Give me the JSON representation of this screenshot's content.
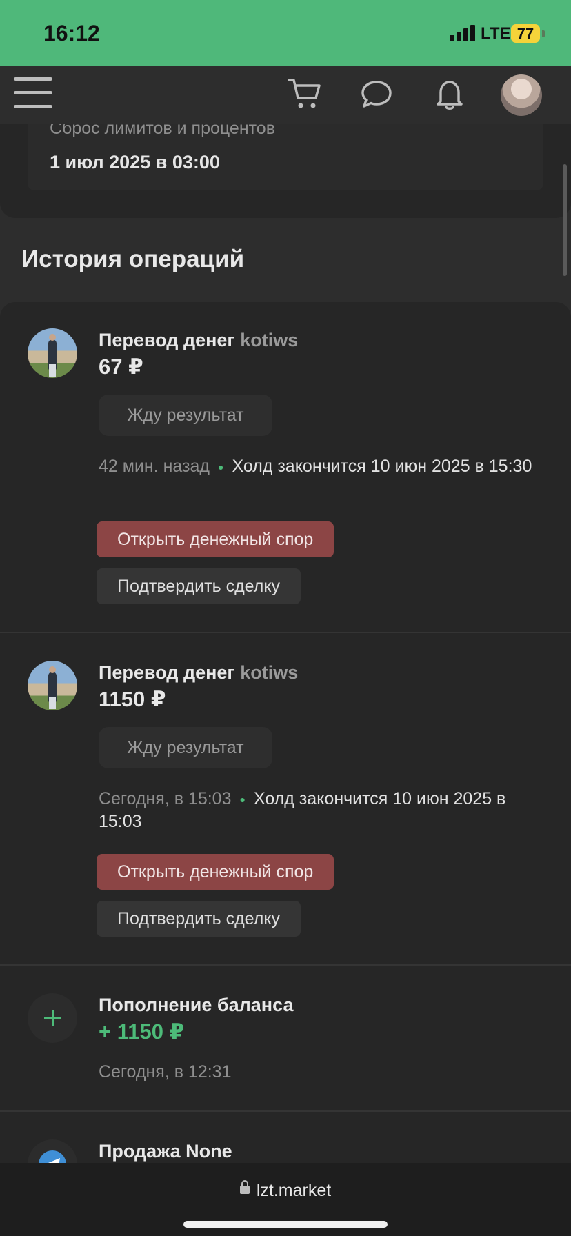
{
  "status_bar": {
    "time": "16:12",
    "network": "LTE",
    "battery": "77"
  },
  "nav": {
    "icons": [
      "menu-icon",
      "cart-icon",
      "chat-icon",
      "bell-icon",
      "avatar"
    ]
  },
  "limits": {
    "label": "Сброс лимитов и процентов",
    "value": "1 июл 2025 в 03:00"
  },
  "history": {
    "title": "История операций",
    "operations": [
      {
        "title": "Перевод денег",
        "user": "kotiws",
        "amount": "67 ₽",
        "status": "Жду результат",
        "when": "42 мин. назад",
        "hold": "Холд закончится 10 июн 2025 в 15:30",
        "dispute_label": "Открыть денежный спор",
        "confirm_label": "Подтвердить сделку"
      },
      {
        "title": "Перевод денег",
        "user": "kotiws",
        "amount": "1150 ₽",
        "status": "Жду результат",
        "when": "Сегодня, в 15:03",
        "hold": "Холд закончится 10 июн 2025 в 15:03",
        "dispute_label": "Открыть денежный спор",
        "confirm_label": "Подтвердить сделку"
      },
      {
        "title": "Пополнение баланса",
        "amount": "+ 1150 ₽",
        "when": "Сегодня, в 12:31"
      },
      {
        "title": "Продажа None"
      }
    ]
  },
  "url_bar": {
    "url": "lzt.market"
  },
  "colors": {
    "status_bar": "#4fb87a",
    "accent_green": "#4dbb79",
    "dispute_button": "#8c4545",
    "background": "#2d2d2d",
    "card": "#262626"
  }
}
